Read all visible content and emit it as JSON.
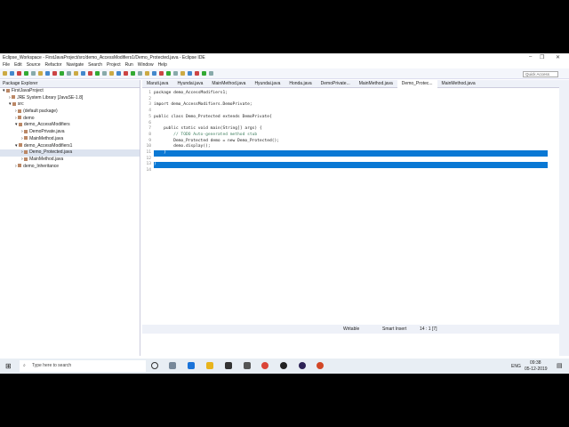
{
  "window": {
    "title": "Eclipse_Workspace - FirstJavaProject/src/demo_AccessModifiers1/Demo_Protected.java - Eclipse IDE",
    "minimize": "–",
    "restore": "❐",
    "close": "✕"
  },
  "menu": [
    "File",
    "Edit",
    "Source",
    "Refactor",
    "Navigate",
    "Search",
    "Project",
    "Run",
    "Window",
    "Help"
  ],
  "quick_access": "Quick Access",
  "package_explorer": {
    "title": "Package Explorer",
    "tree": [
      {
        "label": "FirstJavaProject",
        "indent": 0,
        "arrow": "▾"
      },
      {
        "label": "JRE System Library [JavaSE-1.8]",
        "indent": 1,
        "arrow": "›"
      },
      {
        "label": "src",
        "indent": 1,
        "arrow": "▾"
      },
      {
        "label": "(default package)",
        "indent": 2,
        "arrow": "›"
      },
      {
        "label": "demo",
        "indent": 2,
        "arrow": "›"
      },
      {
        "label": "demo_AccessModifiers",
        "indent": 2,
        "arrow": "▾"
      },
      {
        "label": "DemoPrivate.java",
        "indent": 3,
        "arrow": "›"
      },
      {
        "label": "MainMethod.java",
        "indent": 3,
        "arrow": "›"
      },
      {
        "label": "demo_AccessModifiers1",
        "indent": 2,
        "arrow": "▾"
      },
      {
        "label": "Demo_Protected.java",
        "indent": 3,
        "arrow": "›",
        "selected": true
      },
      {
        "label": "MainMethod.java",
        "indent": 3,
        "arrow": "›"
      },
      {
        "label": "demo_Inheritance",
        "indent": 2,
        "arrow": "›"
      }
    ]
  },
  "tabs": [
    {
      "label": "Maruti.java"
    },
    {
      "label": "Hyundai.java"
    },
    {
      "label": "MainMethod.java"
    },
    {
      "label": "Hyundai.java"
    },
    {
      "label": "Honda.java"
    },
    {
      "label": "DemoPrivate..."
    },
    {
      "label": "MainMethod.java"
    },
    {
      "label": "Demo_Protec...",
      "active": true
    },
    {
      "label": "MainMethod.java"
    }
  ],
  "code": [
    "package demo_AccessModifiers1;",
    "",
    "import demo_AccessModifiers.DemoPrivate;",
    "",
    "public class Demo_Protected extends DemoPrivate{",
    "",
    "    public static void main(String[] args) {",
    "        // TODO Auto-generated method stub",
    "        Demo_Protected demo = new Demo_Protected();",
    "        demo.display();",
    "    }",
    "",
    "}",
    ""
  ],
  "status": {
    "writable": "Writable",
    "insert": "Smart Insert",
    "position": "14 : 1 [7]"
  },
  "taskbar": {
    "search_placeholder": "Type here to search",
    "lang": "ENG",
    "time": "09:38",
    "date": "05-12-2019"
  }
}
